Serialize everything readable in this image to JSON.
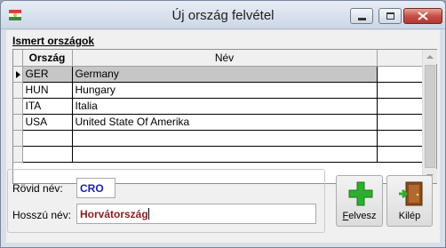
{
  "window": {
    "title": "Új ország felvétel",
    "icon": "flags-icon"
  },
  "section": {
    "label": "Ismert országok"
  },
  "grid": {
    "columns": [
      "Ország",
      "Név"
    ],
    "rows": [
      {
        "code": "GER",
        "name": "Germany"
      },
      {
        "code": "HUN",
        "name": "Hungary"
      },
      {
        "code": "ITA",
        "name": "Italia"
      },
      {
        "code": "USA",
        "name": "United State Of Amerika"
      }
    ]
  },
  "form": {
    "short_label": "Rövid név:",
    "short_value": "CRO",
    "long_label": "Hosszú név:",
    "long_value": "Horvátország"
  },
  "buttons": {
    "add_label_first": "F",
    "add_label_rest": "elvesz",
    "exit_label": "Kilép"
  },
  "colors": {
    "add_icon": "#2eae2e",
    "exit_icon": "#8b4a1c",
    "short_value": "#1e22a8",
    "long_value": "#8b1e1e"
  }
}
